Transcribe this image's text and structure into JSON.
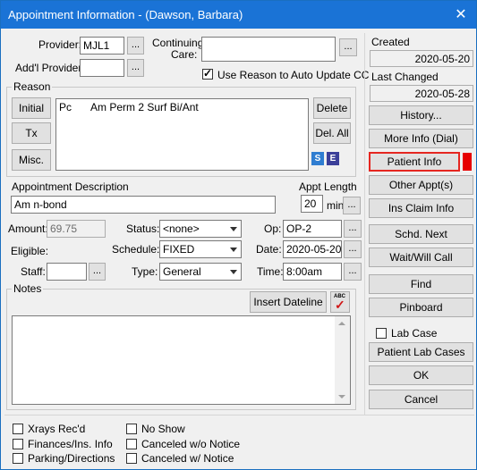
{
  "window": {
    "title": "Appointment Information - (Dawson, Barbara)",
    "close_symbol": "✕"
  },
  "provider": {
    "label": "Provider:",
    "value": "MJL1",
    "button": "..."
  },
  "addl_provider": {
    "label": "Add'l Provider:",
    "value": "",
    "button": "..."
  },
  "continuing_care": {
    "label_line1": "Continuing",
    "label_line2": "Care:",
    "value": "",
    "button": "..."
  },
  "use_reason": {
    "label": "Use Reason to Auto Update CC",
    "checked": true
  },
  "reason": {
    "group_label": "Reason",
    "initial": "Initial",
    "tx": "Tx",
    "misc": "Misc.",
    "delete": "Delete",
    "delete_all": "Del. All",
    "list": [
      {
        "code": "Pc",
        "desc": "Am Perm 2 Surf Bi/Ant"
      }
    ],
    "icon_s": "S",
    "icon_e": "E"
  },
  "appt_desc": {
    "label": "Appointment Description",
    "value": "Am n-bond"
  },
  "appt_length": {
    "label": "Appt Length",
    "value": "20",
    "unit": "min",
    "button": "..."
  },
  "amount": {
    "label": "Amount:",
    "value": "69.75"
  },
  "eligible": {
    "label": "Eligible:"
  },
  "staff": {
    "label": "Staff:",
    "value": "",
    "button": "..."
  },
  "status": {
    "label": "Status:",
    "value": "<none>"
  },
  "schedule": {
    "label": "Schedule:",
    "value": "FIXED"
  },
  "type": {
    "label": "Type:",
    "value": "General"
  },
  "op": {
    "label": "Op:",
    "value": "OP-2",
    "button": "..."
  },
  "date": {
    "label": "Date:",
    "value": "2020-05-20",
    "button": "..."
  },
  "time": {
    "label": "Time:",
    "value": "8:00am",
    "button": "..."
  },
  "notes": {
    "group_label": "Notes",
    "insert_dateline": "Insert Dateline",
    "spell_label": "ABC",
    "value": ""
  },
  "created": {
    "label": "Created",
    "value": "2020-05-20"
  },
  "last_changed": {
    "label": "Last Changed",
    "value": "2020-05-28"
  },
  "right_buttons": {
    "history": "History...",
    "more_info": "More Info (Dial)",
    "patient_info": "Patient Info",
    "other_appts": "Other Appt(s)",
    "ins_claim": "Ins Claim Info",
    "schd_next": "Schd. Next",
    "wait_will_call": "Wait/Will Call",
    "find": "Find",
    "pinboard": "Pinboard",
    "lab_case": "Lab Case",
    "patient_lab_cases": "Patient Lab Cases",
    "ok": "OK",
    "cancel": "Cancel"
  },
  "bottom_checks": {
    "xrays": "Xrays Rec'd",
    "finances": "Finances/Ins. Info",
    "parking": "Parking/Directions",
    "no_show": "No Show",
    "cancel_wo": "Canceled w/o Notice",
    "cancel_w": "Canceled w/ Notice"
  },
  "colors": {
    "title_bar": "#1a73d6",
    "patient_info_border": "#e52620",
    "patient_info_flag": "#e60000",
    "icon_s": "#2f7dd1",
    "icon_e": "#3b3f99"
  }
}
